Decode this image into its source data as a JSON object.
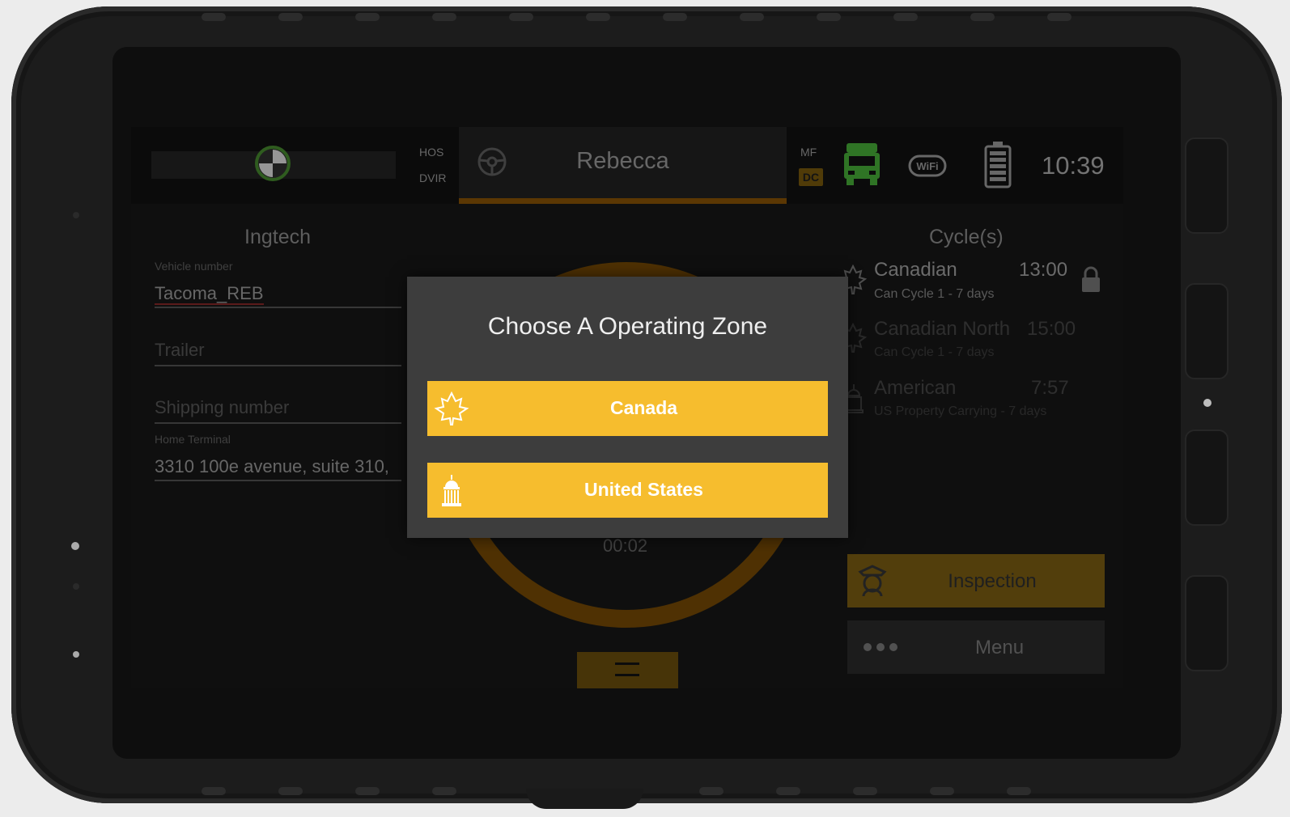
{
  "status_bar": {
    "hos_label": "HOS",
    "dvir_label": "DVIR",
    "driver_name": "Rebecca",
    "mf_label": "MF",
    "dc_label": "DC",
    "time": "10:39"
  },
  "left_panel": {
    "company": "Ingtech",
    "vehicle": {
      "label": "Vehicle number",
      "value": "Tacoma_REB"
    },
    "trailer_placeholder": "Trailer",
    "shipping_placeholder": "Shipping number",
    "home_terminal": {
      "label": "Home Terminal",
      "value": "3310 100e avenue,  suite 310,"
    }
  },
  "center": {
    "timer": "00:02"
  },
  "right_panel": {
    "title": "Cycle(s)",
    "cycles": [
      {
        "name": "Canadian",
        "subtitle": "Can Cycle 1 - 7 days",
        "time": "13:00",
        "icon": "maple-leaf-icon"
      },
      {
        "name": "Canadian North",
        "subtitle": "Can Cycle 1 - 7 days",
        "time": "15:00",
        "icon": "maple-leaf-icon"
      },
      {
        "name": "American",
        "subtitle": "US Property Carrying - 7 days",
        "time": "7:57",
        "icon": "capitol-icon"
      }
    ],
    "inspection_label": "Inspection",
    "menu_label": "Menu"
  },
  "dialog": {
    "title": "Choose A Operating Zone",
    "options": [
      {
        "label": "Canada",
        "icon": "maple-leaf-icon"
      },
      {
        "label": "United States",
        "icon": "capitol-icon"
      }
    ]
  },
  "colors": {
    "accent": "#f6bd2e",
    "dialog_bg": "#3d3d3d",
    "truck_green": "#3f9b32"
  }
}
